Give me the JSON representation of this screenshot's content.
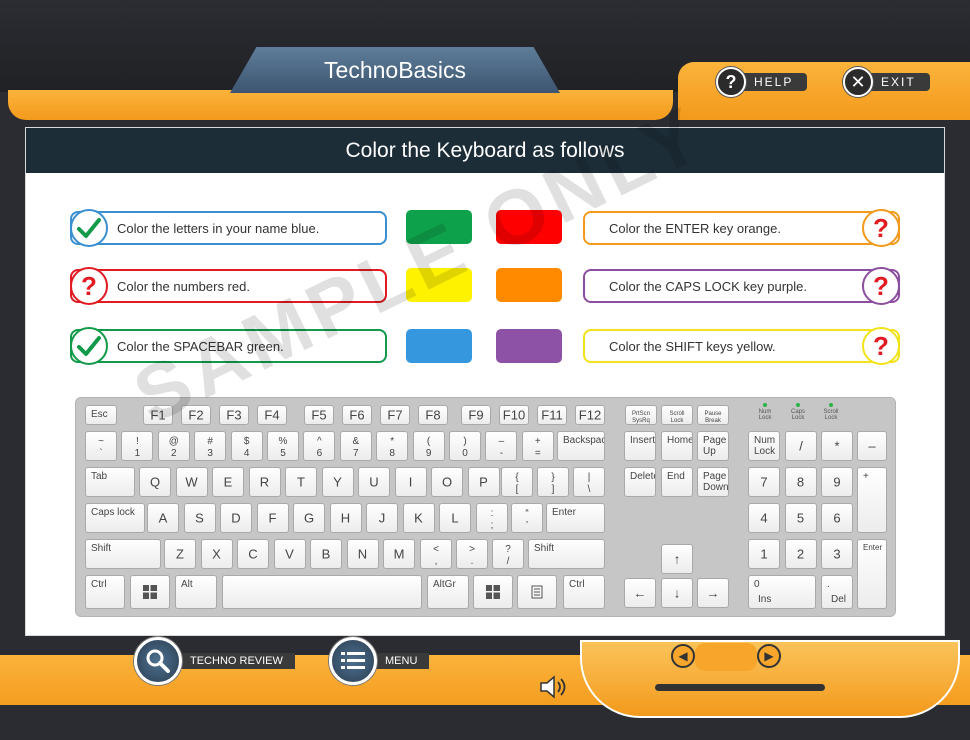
{
  "app": {
    "title": "TechnoBasics"
  },
  "top_nav": {
    "help": "HELP",
    "exit": "EXIT"
  },
  "panel": {
    "heading": "Color the Keyboard as follows"
  },
  "tasks_left": [
    {
      "text": "Color the letters in your name blue.",
      "status": "done",
      "border": "#3a8fd0"
    },
    {
      "text": "Color the numbers red.",
      "status": "todo",
      "border": "#e21a22"
    },
    {
      "text": "Color the SPACEBAR green.",
      "status": "done",
      "border": "#129a4a"
    }
  ],
  "tasks_right": [
    {
      "text": "Color the ENTER key orange.",
      "status": "todo",
      "border": "#f39a1c"
    },
    {
      "text": "Color the CAPS LOCK key purple.",
      "status": "todo",
      "border": "#8c4f9f"
    },
    {
      "text": "Color the SHIFT keys yellow.",
      "status": "todo",
      "border": "#f2e21a"
    }
  ],
  "palette": [
    {
      "name": "green",
      "color": "#0ea14b"
    },
    {
      "name": "red",
      "color": "#ff0000"
    },
    {
      "name": "yellow",
      "color": "#fff200"
    },
    {
      "name": "orange",
      "color": "#ff8a00"
    },
    {
      "name": "blue",
      "color": "#3597dd"
    },
    {
      "name": "purple",
      "color": "#8d52a6"
    }
  ],
  "status_icons": {
    "done": "check-icon",
    "todo": "question-icon"
  },
  "indicators": [
    "Num\nLock",
    "Caps\nLock",
    "Scroll\nLock"
  ],
  "watermark": "SAMPLE ONLY",
  "bottom_nav": {
    "review": "TECHNO REVIEW",
    "menu": "MENU"
  }
}
